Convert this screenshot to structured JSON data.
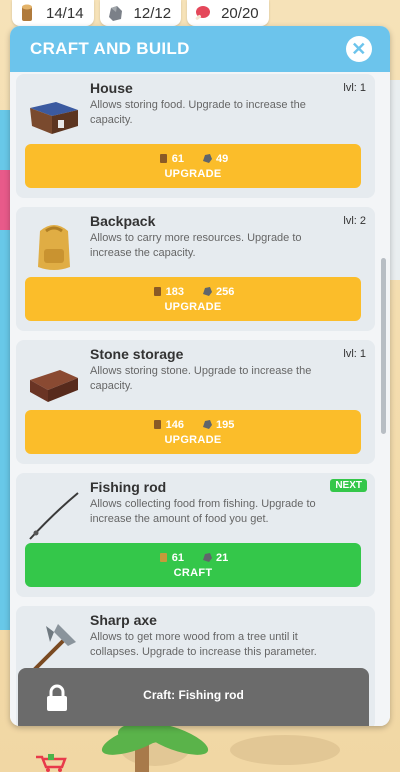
{
  "resources": [
    {
      "icon": "wood-log-icon",
      "value": "14/14"
    },
    {
      "icon": "stone-icon",
      "value": "12/12"
    },
    {
      "icon": "meat-icon",
      "value": "20/20"
    }
  ],
  "panel": {
    "title": "CRAFT AND BUILD",
    "close_icon": "close-icon"
  },
  "items": [
    {
      "name": "House",
      "level": "lvl: 1",
      "description": "Allows storing food. Upgrade to increase the capacity.",
      "wood": "61",
      "stone": "49",
      "action": "UPGRADE",
      "icon": "house-icon"
    },
    {
      "name": "Backpack",
      "level": "lvl: 2",
      "description": "Allows to carry more resources. Upgrade to increase the capacity.",
      "wood": "183",
      "stone": "256",
      "action": "UPGRADE",
      "icon": "backpack-icon"
    },
    {
      "name": "Stone storage",
      "level": "lvl: 1",
      "description": "Allows storing stone. Upgrade to increase the capacity.",
      "wood": "146",
      "stone": "195",
      "action": "UPGRADE",
      "icon": "stone-storage-icon"
    },
    {
      "name": "Fishing rod",
      "badge": "NEXT",
      "description": "Allows collecting food from fishing. Upgrade to increase the amount of food you get.",
      "wood": "61",
      "stone": "21",
      "action": "CRAFT",
      "icon": "fishing-rod-icon"
    },
    {
      "name": "Sharp axe",
      "description": "Allows to get more wood from a tree until it collapses. Upgrade to increase this parameter.",
      "icon": "axe-icon"
    }
  ],
  "craft_bar": {
    "label": "Craft: Fishing rod",
    "icon": "lock-icon"
  },
  "colors": {
    "header": "#6cc4ec",
    "upgrade": "#fbbd2a",
    "craft": "#34c74a",
    "craft_bar": "#6b6b6b"
  }
}
